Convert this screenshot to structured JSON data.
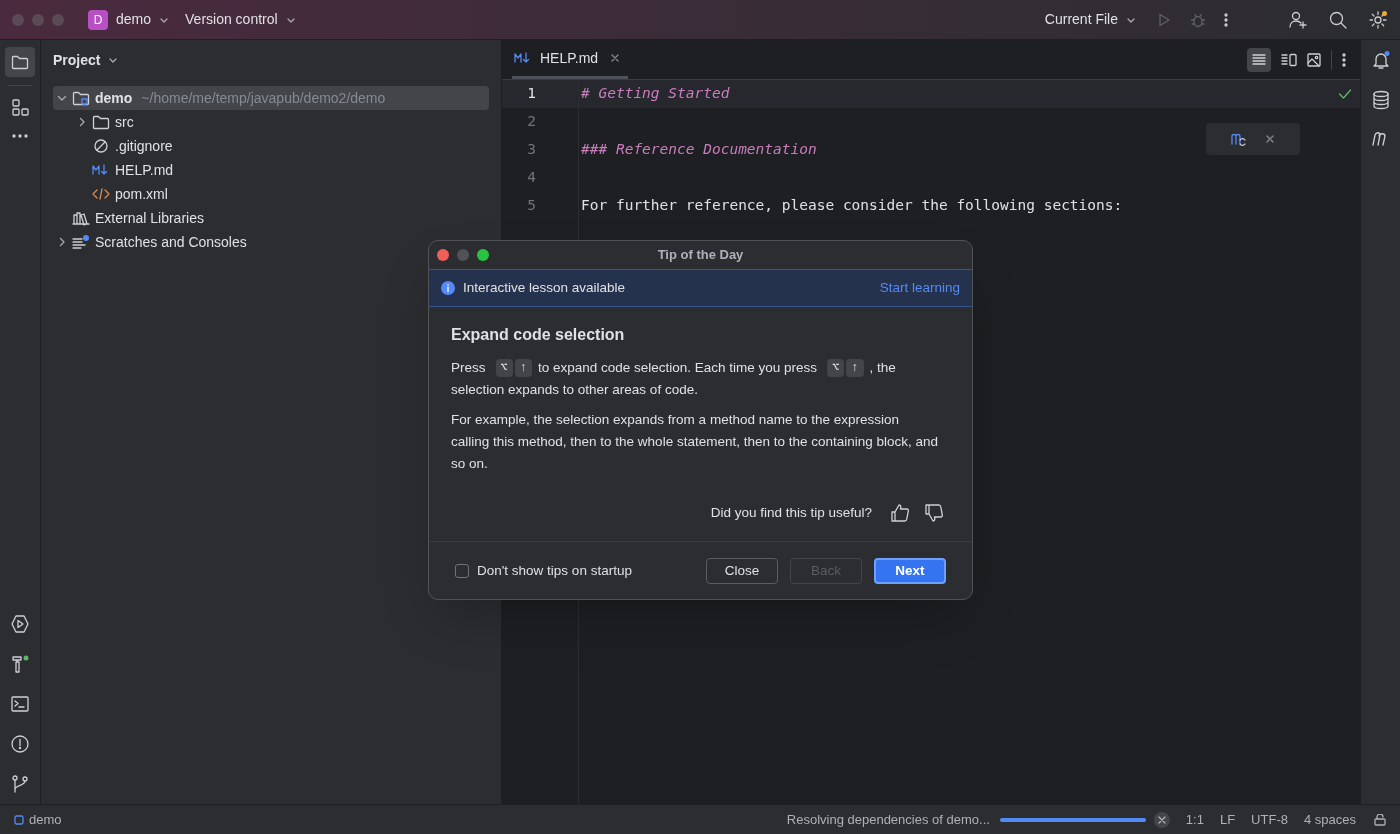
{
  "title_bar": {
    "project_badge": "D",
    "project": "demo",
    "vcs": "Version control",
    "run_config": "Current File"
  },
  "project_panel": {
    "title": "Project",
    "tree": [
      {
        "label": "demo",
        "path": "~/home/me/temp/javapub/demo2/demo",
        "kind": "module",
        "expanded": true,
        "selected": true,
        "children": [
          {
            "label": "src",
            "kind": "folder",
            "expanded": false
          },
          {
            "label": ".gitignore",
            "kind": "ignore"
          },
          {
            "label": "HELP.md",
            "kind": "markdown"
          },
          {
            "label": "pom.xml",
            "kind": "xml"
          }
        ]
      },
      {
        "label": "External Libraries",
        "kind": "library"
      },
      {
        "label": "Scratches and Consoles",
        "kind": "scratch",
        "expanded": false
      }
    ]
  },
  "editor": {
    "tabs": [
      {
        "label": "HELP.md",
        "selected": true
      }
    ],
    "lines": [
      {
        "number": "1",
        "text": "# Getting Started",
        "kind": "heading",
        "current": true
      },
      {
        "number": "2",
        "current": false
      },
      {
        "number": "3",
        "text": "### Reference Documentation",
        "kind": "heading",
        "current": false
      },
      {
        "number": "4",
        "current": false
      },
      {
        "number": "5",
        "text": "For further reference, please consider the following sections:",
        "kind": "plain",
        "current": false
      }
    ]
  },
  "dialog": {
    "title": "Tip of the Day",
    "banner": {
      "text": "Interactive lesson available",
      "link": "Start learning"
    },
    "heading": "Expand code selection",
    "paragraphs": [
      {
        "lines": [
          [
            "Press",
            "⌥",
            "↑",
            "to expand code selection. Each time you press",
            "⌥",
            "↑",
            ", the"
          ],
          [
            "selection expands to other areas of code."
          ]
        ]
      },
      {
        "lines": [
          [
            "For example, the selection expands from a method name to the expression calling this method, then to the whole statement, then to the containing block, and so on."
          ]
        ]
      }
    ],
    "feedback": "Did you find this tip useful?",
    "checkbox": {
      "label": "Don't show tips on startup",
      "checked": false
    },
    "buttons": [
      {
        "label": "Close",
        "kind": "normal",
        "disabled": false
      },
      {
        "label": "Back",
        "kind": "normal",
        "disabled": true
      },
      {
        "label": "Next",
        "kind": "primary",
        "disabled": false
      }
    ]
  },
  "status_bar": {
    "project": "demo",
    "task": "Resolving dependencies of demo...",
    "progress": {
      "level": 1
    },
    "items": [
      "1:1",
      "LF",
      "UTF-8",
      "4 spaces"
    ]
  }
}
